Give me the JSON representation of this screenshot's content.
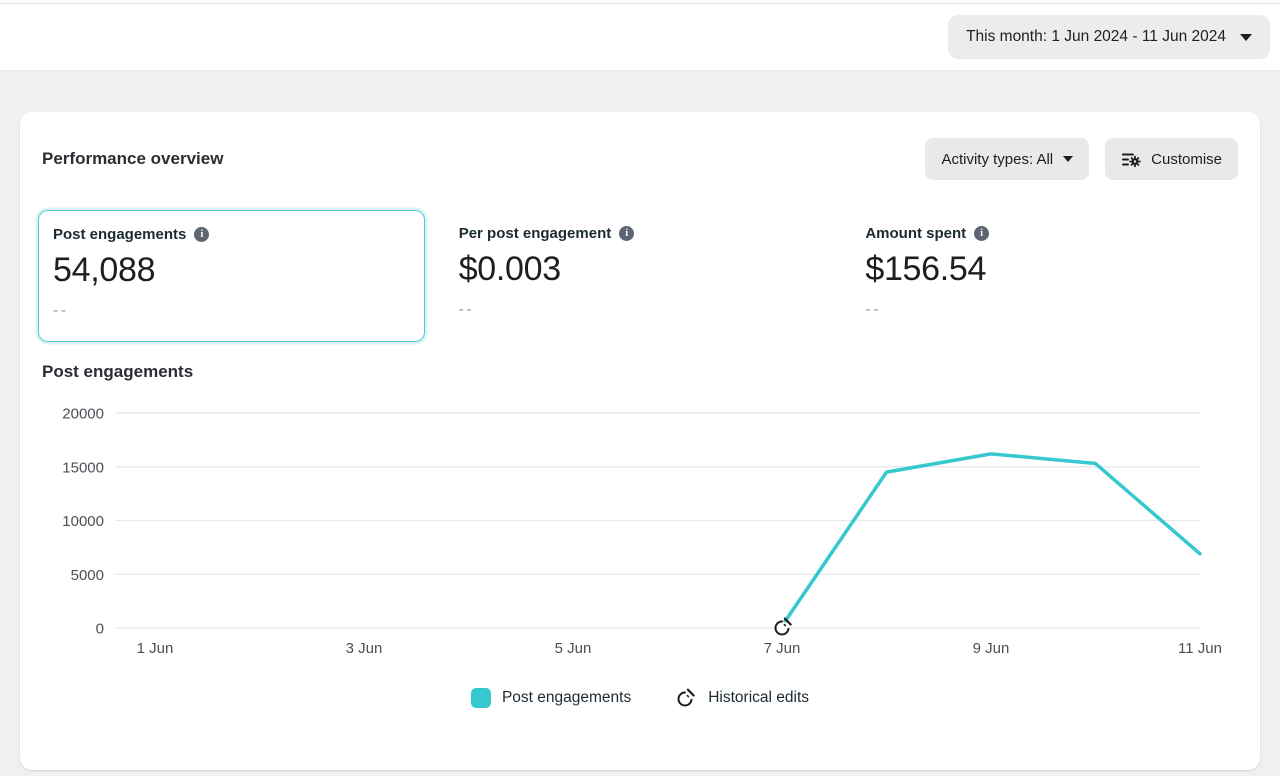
{
  "topbar": {
    "date_range_label": "This month: 1 Jun 2024 - 11 Jun 2024"
  },
  "overview": {
    "title": "Performance overview",
    "activity_types_label": "Activity types: All",
    "customise_label": "Customise"
  },
  "metrics": [
    {
      "label": "Post engagements",
      "value": "54,088",
      "comparison": "--",
      "selected": true
    },
    {
      "label": "Per post engagement",
      "value": "$0.003",
      "comparison": "--",
      "selected": false
    },
    {
      "label": "Amount spent",
      "value": "$156.54",
      "comparison": "--",
      "selected": false
    }
  ],
  "chart_data": {
    "type": "line",
    "title": "Post engagements",
    "xlabel": "",
    "ylabel": "",
    "ylim": [
      0,
      20000
    ],
    "y_ticks": [
      0,
      5000,
      10000,
      15000,
      20000
    ],
    "x_domain_days": [
      1,
      11
    ],
    "x_ticks": [
      {
        "day": 1,
        "label": "1 Jun"
      },
      {
        "day": 3,
        "label": "3 Jun"
      },
      {
        "day": 5,
        "label": "5 Jun"
      },
      {
        "day": 7,
        "label": "7 Jun"
      },
      {
        "day": 9,
        "label": "9 Jun"
      },
      {
        "day": 11,
        "label": "11 Jun"
      }
    ],
    "grid": true,
    "legend_position": "bottom",
    "series": [
      {
        "name": "Post engagements",
        "color": "#35C8CF",
        "points": [
          {
            "x": "7 Jun",
            "day": 7,
            "value": 200
          },
          {
            "x": "8 Jun",
            "day": 8,
            "value": 14500
          },
          {
            "x": "9 Jun",
            "day": 9,
            "value": 16200
          },
          {
            "x": "10 Jun",
            "day": 10,
            "value": 15300
          },
          {
            "x": "11 Jun",
            "day": 11,
            "value": 6900
          }
        ]
      }
    ],
    "annotations": [
      {
        "type": "historical-edit",
        "x": "7 Jun",
        "day": 7,
        "value": 0
      }
    ],
    "legend": [
      {
        "label": "Post engagements",
        "swatch_color": "#35C8CF"
      },
      {
        "label": "Historical edits",
        "icon": "historical-edits-icon"
      }
    ]
  },
  "colors": {
    "accent_teal": "#35C8CF",
    "selected_border": "#54C9D1",
    "page_bg": "#F0F0F1",
    "button_bg": "#E9E9E9",
    "gridline": "#E6E8EC",
    "axis_text": "#4B4F56",
    "text_primary": "#1C2B33",
    "muted_text": "#8D9197"
  }
}
